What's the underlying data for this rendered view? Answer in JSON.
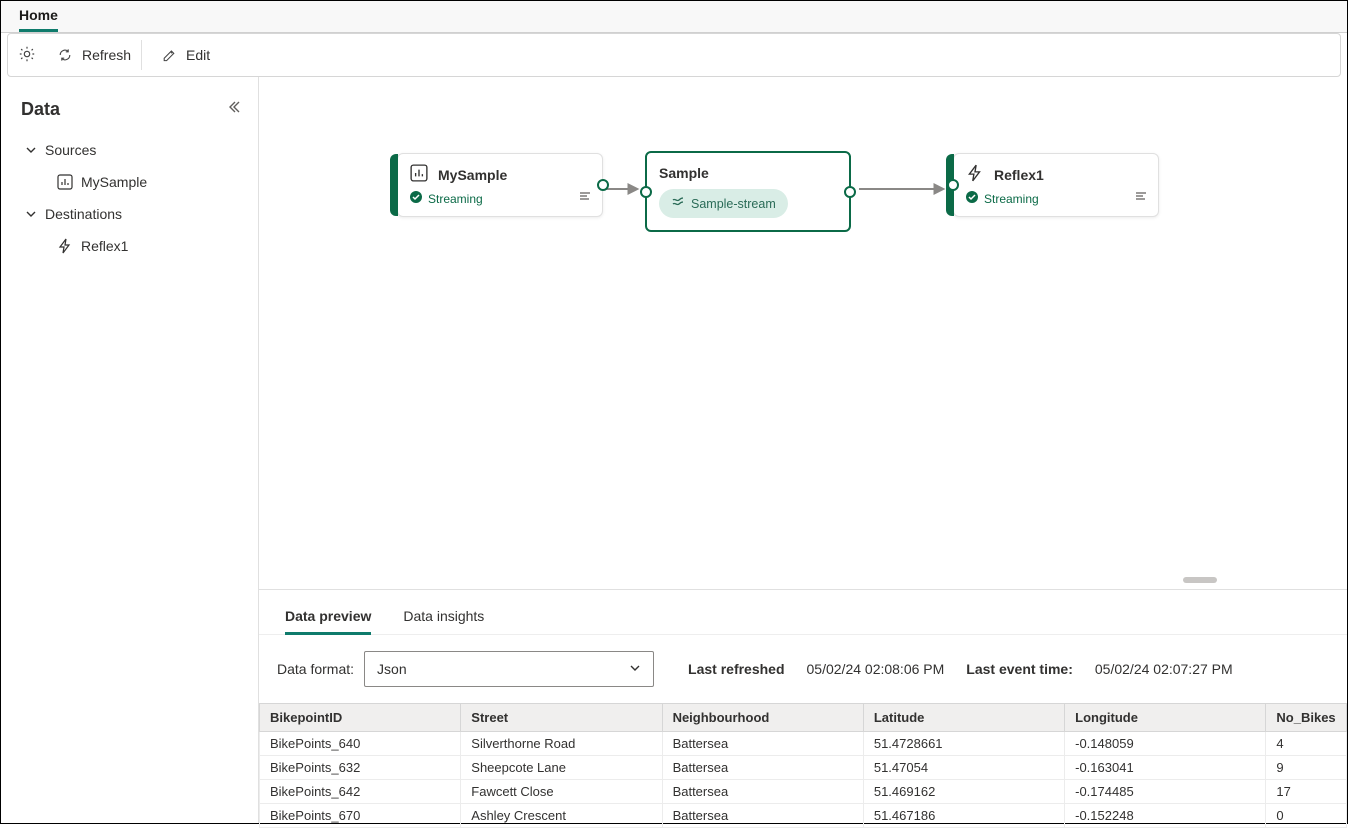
{
  "topTab": "Home",
  "toolbar": {
    "refresh": "Refresh",
    "edit": "Edit"
  },
  "sidebar": {
    "title": "Data",
    "groups": [
      {
        "label": "Sources",
        "items": [
          {
            "label": "MySample",
            "iconName": "barchart-icon"
          }
        ]
      },
      {
        "label": "Destinations",
        "items": [
          {
            "label": "Reflex1",
            "iconName": "lightning-icon"
          }
        ]
      }
    ]
  },
  "nodes": {
    "source": {
      "title": "MySample",
      "status": "Streaming"
    },
    "center": {
      "title": "Sample",
      "stream": "Sample-stream"
    },
    "dest": {
      "title": "Reflex1",
      "status": "Streaming"
    }
  },
  "bottomTabs": {
    "preview": "Data preview",
    "insights": "Data insights"
  },
  "format": {
    "label": "Data format:",
    "value": "Json"
  },
  "meta": {
    "refreshedLabel": "Last refreshed",
    "refreshedValue": "05/02/24 02:08:06 PM",
    "eventLabel": "Last event time:",
    "eventValue": "05/02/24 02:07:27 PM"
  },
  "table": {
    "headers": [
      "BikepointID",
      "Street",
      "Neighbourhood",
      "Latitude",
      "Longitude",
      "No_Bikes"
    ],
    "rows": [
      [
        "BikePoints_640",
        "Silverthorne Road",
        "Battersea",
        "51.4728661",
        "-0.148059",
        "4"
      ],
      [
        "BikePoints_632",
        "Sheepcote Lane",
        "Battersea",
        "51.47054",
        "-0.163041",
        "9"
      ],
      [
        "BikePoints_642",
        "Fawcett Close",
        "Battersea",
        "51.469162",
        "-0.174485",
        "17"
      ],
      [
        "BikePoints_670",
        "Ashley Crescent",
        "Battersea",
        "51.467186",
        "-0.152248",
        "0"
      ]
    ]
  }
}
